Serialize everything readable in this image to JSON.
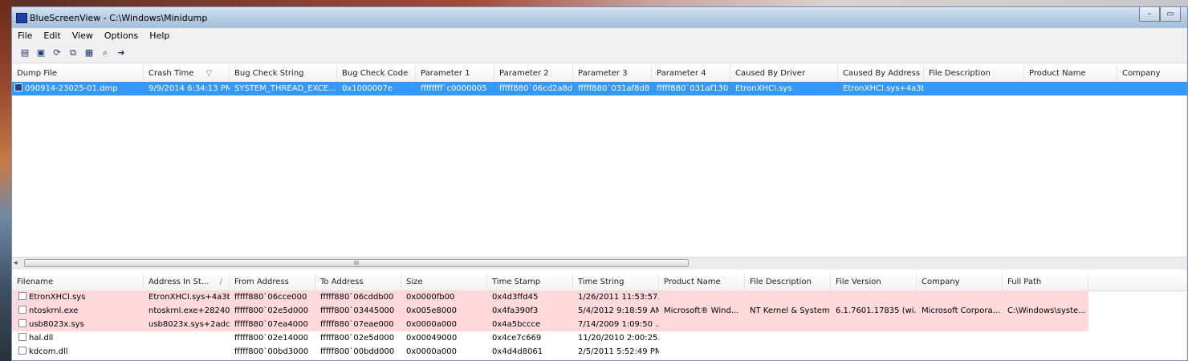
{
  "window": {
    "title": "BlueScreenView  -  C:\\Windows\\Minidump",
    "minimize_glyph": "–",
    "maximize_glyph": "▭"
  },
  "menu": [
    "File",
    "Edit",
    "View",
    "Options",
    "Help"
  ],
  "toolbar": [
    {
      "icon": "properties-icon",
      "glyph": "▤"
    },
    {
      "icon": "save-icon",
      "glyph": "▣"
    },
    {
      "icon": "refresh-icon",
      "glyph": "⟳"
    },
    {
      "icon": "copy-icon",
      "glyph": "⧉"
    },
    {
      "icon": "html-report-icon",
      "glyph": "▦"
    },
    {
      "icon": "find-icon",
      "glyph": "⌕"
    },
    {
      "icon": "exit-icon",
      "glyph": "➜"
    }
  ],
  "top_table": {
    "columns": [
      "Dump File",
      "Crash Time",
      "Bug Check String",
      "Bug Check Code",
      "Parameter 1",
      "Parameter 2",
      "Parameter 3",
      "Parameter 4",
      "Caused By Driver",
      "Caused By Address",
      "File Description",
      "Product Name",
      "Company"
    ],
    "sort_glyph": "▽",
    "rows": [
      [
        "090914-23025-01.dmp",
        "9/9/2014 6:34:13 PM",
        "SYSTEM_THREAD_EXCE...",
        "0x1000007e",
        "ffffffff`c0000005",
        "fffff880`06cd2a8d",
        "fffff880`031af8d8",
        "fffff880`031af130",
        "EtronXHCI.sys",
        "EtronXHCI.sys+4a3b",
        "",
        "",
        ""
      ]
    ]
  },
  "scrollbar": {
    "left_arrow": "◂",
    "grip": "III"
  },
  "bottom_table": {
    "columns": [
      "Filename",
      "Address In St...",
      "From Address",
      "To Address",
      "Size",
      "Time Stamp",
      "Time String",
      "Product Name",
      "File Description",
      "File Version",
      "Company",
      "Full Path"
    ],
    "sort_glyph": "/",
    "rows": [
      {
        "hl": true,
        "cells": [
          "EtronXHCI.sys",
          "EtronXHCI.sys+4a3b",
          "fffff880`06cce000",
          "fffff880`06cddb00",
          "0x0000fb00",
          "0x4d3ffd45",
          "1/26/2011 11:53:57...",
          "",
          "",
          "",
          "",
          ""
        ]
      },
      {
        "hl": true,
        "cells": [
          "ntoskrnl.exe",
          "ntoskrnl.exe+28240",
          "fffff800`02e5d000",
          "fffff800`03445000",
          "0x005e8000",
          "0x4fa390f3",
          "5/4/2012 9:18:59 AM",
          "Microsoft® Wind...",
          "NT Kernel & System",
          "6.1.7601.17835 (wi...",
          "Microsoft Corpora...",
          "C:\\Windows\\syste..."
        ]
      },
      {
        "hl": true,
        "cells": [
          "usb8023x.sys",
          "usb8023x.sys+2adc",
          "fffff880`07ea4000",
          "fffff880`07eae000",
          "0x0000a000",
          "0x4a5bccce",
          "7/14/2009 1:09:50 ...",
          "",
          "",
          "",
          "",
          ""
        ]
      },
      {
        "hl": false,
        "cells": [
          "hal.dll",
          "",
          "fffff800`02e14000",
          "fffff800`02e5d000",
          "0x00049000",
          "0x4ce7c669",
          "11/20/2010 2:00:25...",
          "",
          "",
          "",
          "",
          ""
        ]
      },
      {
        "hl": false,
        "cells": [
          "kdcom.dll",
          "",
          "fffff800`00bd3000",
          "fffff800`00bdd000",
          "0x0000a000",
          "0x4d4d8061",
          "2/5/2011 5:52:49 PM",
          "",
          "",
          "",
          "",
          ""
        ]
      }
    ]
  },
  "colors": {
    "selection": "#3399ff",
    "highlight_rows": "#ffd9dc"
  }
}
